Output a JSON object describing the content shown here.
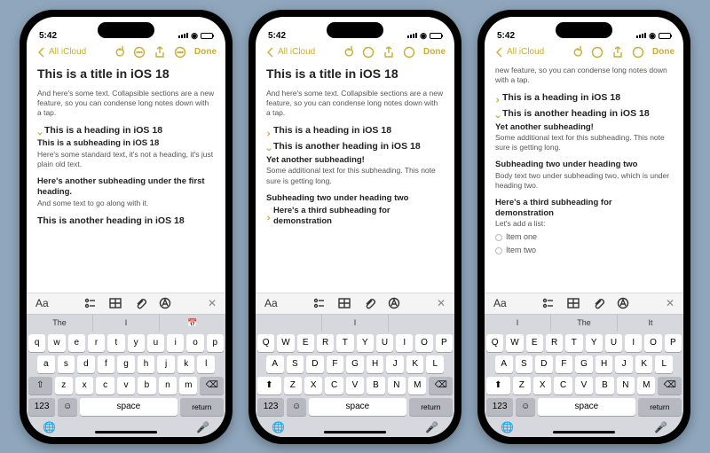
{
  "status": {
    "time": "5:42",
    "battery_pct": 60
  },
  "nav": {
    "back": "All iCloud",
    "done": "Done"
  },
  "kbd_lower": {
    "row1": [
      "q",
      "w",
      "e",
      "r",
      "t",
      "y",
      "u",
      "i",
      "o",
      "p"
    ],
    "row2": [
      "a",
      "s",
      "d",
      "f",
      "g",
      "h",
      "j",
      "k",
      "l"
    ],
    "row3": [
      "z",
      "x",
      "c",
      "v",
      "b",
      "n",
      "m"
    ],
    "num": "123",
    "return": "return"
  },
  "kbd_upper": {
    "row1": [
      "Q",
      "W",
      "E",
      "R",
      "T",
      "Y",
      "U",
      "I",
      "O",
      "P"
    ],
    "row2": [
      "A",
      "S",
      "D",
      "F",
      "G",
      "H",
      "J",
      "K",
      "L"
    ],
    "row3": [
      "Z",
      "X",
      "C",
      "V",
      "B",
      "N",
      "M"
    ],
    "num": "123",
    "return": "return"
  },
  "phone1": {
    "suggest": [
      "The",
      "I",
      "📅"
    ],
    "title": "This is a title in iOS 18",
    "intro": "And here's some text. Collapsible sections are a new feature, so you can condense long notes down with a tap.",
    "h1": "This is a heading in iOS 18",
    "sh1": "This is a subheading in iOS 18",
    "p1": "Here's some standard text, it's not a heading, it's just plain old text.",
    "sh2": "Here's another subheading under the first heading.",
    "p2": "And some text to go along with it.",
    "h2": "This is another heading in iOS 18"
  },
  "phone2": {
    "suggest": [
      "",
      "I",
      ""
    ],
    "title": "This is a title in iOS 18",
    "intro": "And here's some text. Collapsible sections are a new feature, so you can condense long notes down with a tap.",
    "h1": "This is a heading in iOS 18",
    "h2": "This is another heading in iOS 18",
    "sh1": "Yet another subheading!",
    "p1": "Some additional text for this subheading. This note sure is getting long.",
    "sh2": "Subheading two under heading two",
    "sh3": "Here's a third subheading for demonstration"
  },
  "phone3": {
    "suggest": [
      "I",
      "The",
      "It"
    ],
    "intro": "new feature, so you can condense long notes down with a tap.",
    "h1": "This is a heading in iOS 18",
    "h2": "This is another heading in iOS 18",
    "sh1": "Yet another subheading!",
    "p1": "Some additional text for this subheading. This note sure is getting long.",
    "sh2": "Subheading two under heading two",
    "p2": "Body text two under subheading two, which is under heading two.",
    "sh3": "Here's a third subheading for demonstration",
    "p3": "Let's add a list:",
    "li1": "Item one",
    "li2": "Item two"
  }
}
